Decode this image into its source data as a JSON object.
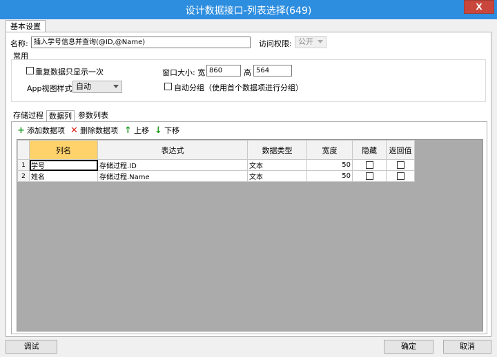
{
  "window": {
    "title": "设计数据接口-列表选择(649)",
    "close_label": "X"
  },
  "tab": {
    "label": "基本设置"
  },
  "form": {
    "name_label": "名称:",
    "name_value": "插入学号信息并查询(@ID,@Name)",
    "access_label": "访问权限:",
    "access_value": "公开",
    "group_title": "常用",
    "repeat_label": "重复数据只显示一次",
    "window_size_label": "窗口大小: 宽",
    "width_value": "860",
    "height_label": "高",
    "height_value": "564",
    "app_view_label": "App视图样式",
    "app_view_value": "自动",
    "auto_group_label": "自动分组（使用首个数据项进行分组）"
  },
  "inner_tabs": [
    "存储过程",
    "数据列",
    "参数列表"
  ],
  "toolbar": {
    "add": "添加数据项",
    "delete": "删除数据项",
    "up": "上移",
    "down": "下移"
  },
  "grid": {
    "columns": [
      "列名",
      "表达式",
      "数据类型",
      "宽度",
      "隐藏",
      "返回值"
    ],
    "rows": [
      {
        "num": "1",
        "name": "学号",
        "expr": "存储过程.ID",
        "type": "文本",
        "width": "50",
        "hidden": false,
        "ret": false
      },
      {
        "num": "2",
        "name": "姓名",
        "expr": "存储过程.Name",
        "type": "文本",
        "width": "50",
        "hidden": false,
        "ret": false
      }
    ]
  },
  "buttons": {
    "debug": "调试",
    "ok": "确定",
    "cancel": "取消"
  },
  "colors": {
    "titlebar": "#2d8ee0",
    "close": "#c9463d",
    "selected_header": "#ffd26b",
    "add_icon": "#1f9a1f",
    "delete_icon": "#d9231a"
  }
}
